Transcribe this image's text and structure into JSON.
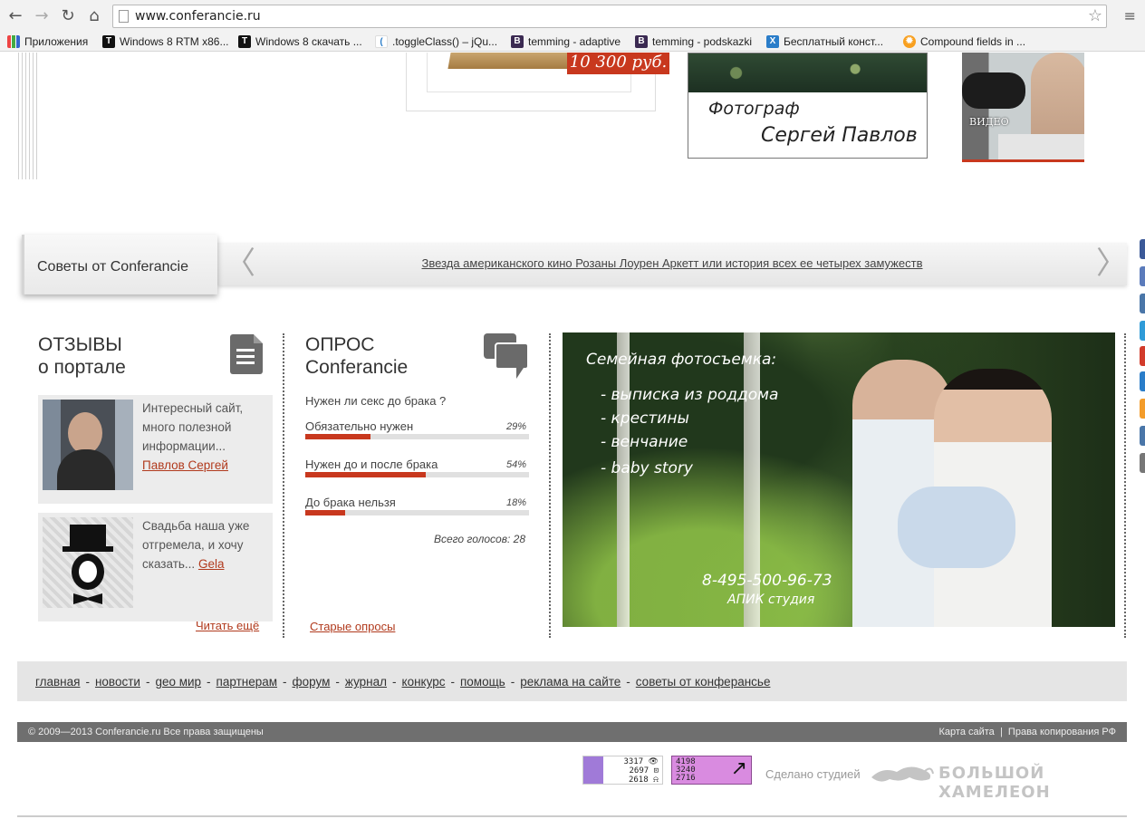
{
  "browser": {
    "url": "www.conferancie.ru",
    "back_glyph": "←",
    "forward_glyph": "→",
    "reload_glyph": "↻",
    "home_glyph": "⌂",
    "star_glyph": "☆",
    "menu_glyph": "≡",
    "bookmarks": [
      {
        "label": "Приложения",
        "icon": "apps-icon"
      },
      {
        "label": "Windows 8 RTM x86...",
        "icon": "t-icon"
      },
      {
        "label": "Windows 8 скачать ...",
        "icon": "t-icon"
      },
      {
        "label": ".toggleClass() – jQu...",
        "icon": "jquery-icon"
      },
      {
        "label": "temming - adaptive",
        "icon": "b-icon"
      },
      {
        "label": "temming - podskazki",
        "icon": "b-icon"
      },
      {
        "label": "Бесплатный конст...",
        "icon": "x-icon"
      },
      {
        "label": "Compound fields in ...",
        "icon": "c-icon"
      }
    ]
  },
  "top": {
    "price": "10 300 руб.",
    "photographer_line1": "Фотограф",
    "photographer_line2": "Сергей Павлов",
    "video_label": "ВИДЕО"
  },
  "tips": {
    "label": "Советы от Conferancie",
    "link": "Звезда американского кино Розаны Лоурен Аркетт или история всех ее четырех замужеств",
    "prev_glyph": "〈",
    "next_glyph": "〉"
  },
  "reviews": {
    "title_line1": "ОТЗЫВЫ",
    "title_line2": "о портале",
    "items": [
      {
        "text": "Интересный сайт, много полезной информации...",
        "author": "Павлов Сергей"
      },
      {
        "text": "Свадьба наша уже отгремела, и хочу сказать...",
        "author": "Gela"
      }
    ],
    "read_more": "Читать ещё"
  },
  "poll": {
    "title_line1": "ОПРОС",
    "title_line2": "Conferancie",
    "question": "Нужен ли секс до брака ?",
    "options": [
      {
        "label": "Обязательно нужен",
        "percent_label": "29%",
        "percent": 29
      },
      {
        "label": "Нужен до и после брака",
        "percent_label": "54%",
        "percent": 54
      },
      {
        "label": "До брака нельзя",
        "percent_label": "18%",
        "percent": 18
      }
    ],
    "total": "Всего голосов: 28",
    "old_polls": "Старые опросы"
  },
  "banner": {
    "heading": "Семейная фотосъемка:",
    "items": [
      "- выписка из роддома",
      "- крестины",
      "- венчание",
      "- baby story"
    ],
    "phone": "8-495-500-96-73",
    "studio": "АПИК студия"
  },
  "footer": {
    "nav": [
      "главная",
      "новости",
      "geo мир",
      "партнерам",
      "форум",
      "журнал",
      "конкурс",
      "помощь",
      "реклама на сайте",
      "советы от конферансье"
    ],
    "nav_separator": "-",
    "copyright": "© 2009—2013  Conferancie.ru  Все права защищены",
    "sitemap": "Карта сайта",
    "divider": "|",
    "rights": "Права копирования РФ",
    "counter1": [
      "3317 👁",
      "2697 ⊡",
      "2618 ⍾"
    ],
    "counter2": [
      "4198",
      "3240",
      "2716"
    ],
    "made_by": "Сделано студией",
    "studio_name": "БОЛЬШОЙ ХАМЕЛЕОН"
  },
  "colors": {
    "accent": "#c8381e",
    "link": "#b13a1d",
    "share_strip": [
      "#3b5998",
      "#5b7bbb",
      "#4a76a8",
      "#2f9bd8",
      "#d23b2b",
      "#2a7dc9",
      "#f39c2a",
      "#4a76a8",
      "#777777"
    ]
  }
}
